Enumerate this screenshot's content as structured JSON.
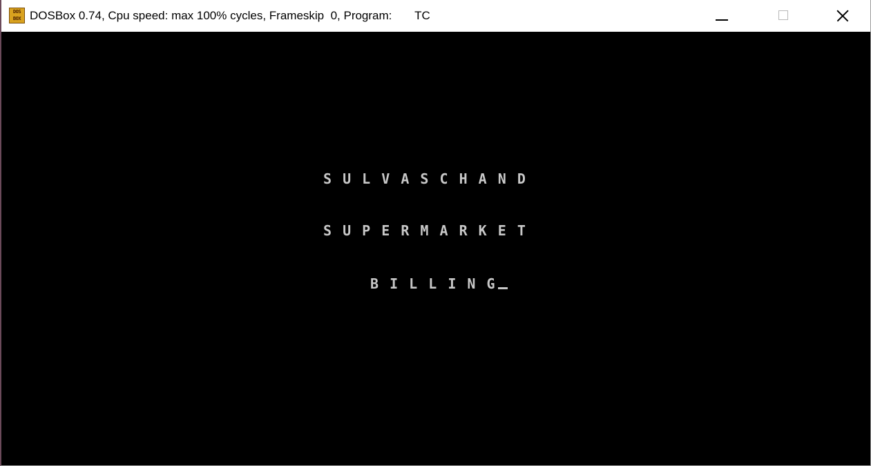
{
  "window": {
    "title": "DOSBox 0.74, Cpu speed: max 100% cycles, Frameskip  0, Program:       TC",
    "icon": "dosbox-icon",
    "icon_text_top": "DOS",
    "icon_text_bottom": "BOX",
    "controls": {
      "minimize": "minimize-icon",
      "maximize": "maximize-icon",
      "close": "close-icon"
    }
  },
  "screen": {
    "lines": [
      "S U L V A S C H A N D",
      "S U P E R M A R K E T",
      "B I L L I N G"
    ],
    "cursor": "_"
  },
  "colors": {
    "screen_bg": "#000000",
    "screen_text": "#c8c8c8",
    "titlebar_bg": "#ffffff",
    "icon_bg": "#d9a21f"
  }
}
